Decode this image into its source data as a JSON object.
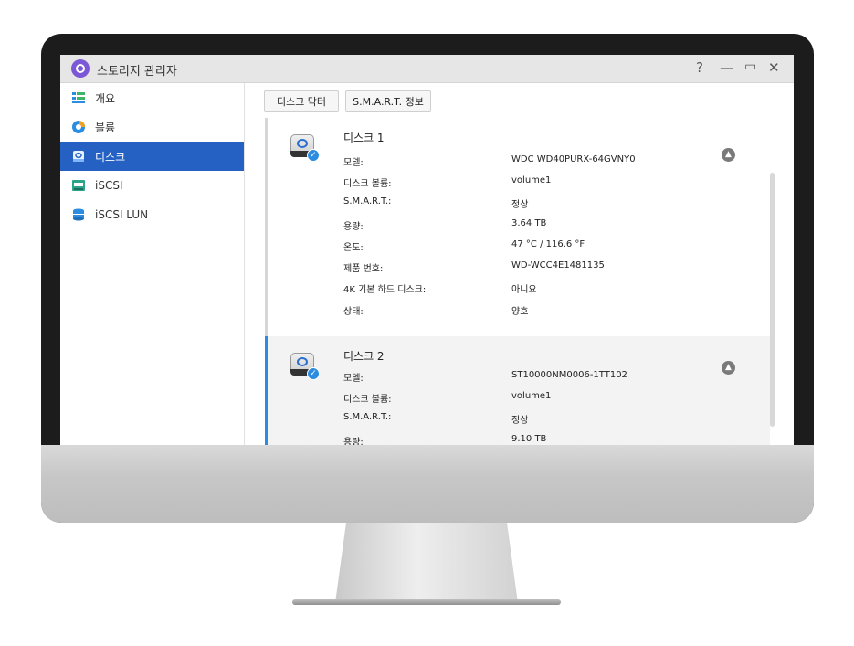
{
  "window": {
    "title": "스토리지 관리자",
    "controls": {
      "help": "?",
      "minimize": "—",
      "maximize": "▭",
      "close": "✕"
    }
  },
  "sidebar": {
    "items": [
      {
        "label": "개요",
        "icon": "overview-icon"
      },
      {
        "label": "볼륨",
        "icon": "volume-pie-icon"
      },
      {
        "label": "디스크",
        "icon": "disk-icon",
        "active": true
      },
      {
        "label": "iSCSI",
        "icon": "iscsi-icon"
      },
      {
        "label": "iSCSI LUN",
        "icon": "iscsi-lun-icon"
      }
    ]
  },
  "toolbar": {
    "disk_doctor": "디스크 닥터",
    "smart_info": "S.M.A.R.T. 정보"
  },
  "disks": [
    {
      "name": "디스크 1",
      "rows": [
        {
          "label": "모델:",
          "value": "WDC WD40PURX-64GVNY0"
        },
        {
          "label": "디스크 볼륨:",
          "value": "volume1"
        },
        {
          "label": "S.M.A.R.T.:",
          "value": "정상"
        },
        {
          "label": "용량:",
          "value": "3.64 TB"
        },
        {
          "label": "온도:",
          "value": "47 °C / 116.6 °F"
        },
        {
          "label": "제품 번호:",
          "value": "WD-WCC4E1481135"
        },
        {
          "label": "4K 기본 하드 디스크:",
          "value": "아니요"
        },
        {
          "label": "상태:",
          "value": "양호"
        }
      ]
    },
    {
      "name": "디스크 2",
      "rows": [
        {
          "label": "모델:",
          "value": "ST10000NM0006-1TT102"
        },
        {
          "label": "디스크 볼륨:",
          "value": "volume1"
        },
        {
          "label": "S.M.A.R.T.:",
          "value": "정상"
        },
        {
          "label": "용량:",
          "value": "9.10 TB"
        }
      ]
    }
  ],
  "colors": {
    "accent": "#2461c2",
    "selected_card_border": "#2b8ce0",
    "app_icon": "#7a58d6"
  }
}
